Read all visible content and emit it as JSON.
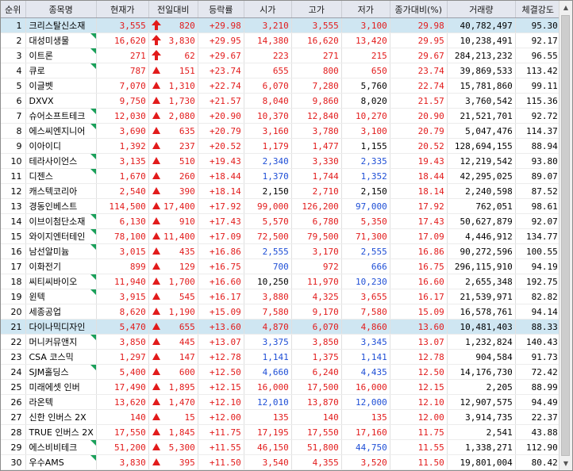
{
  "headers": [
    "순위",
    "종목명",
    "현재가",
    "전일대비",
    "등락률",
    "시가",
    "고가",
    "저가",
    "종가대비(%)",
    "거래량",
    "체결강도"
  ],
  "rows": [
    {
      "rank": "1",
      "name": "크리스탈신소재",
      "price": "3,555",
      "change": "820",
      "pct": "+29.98",
      "open": "3,210",
      "high": "3,555",
      "low": "3,100",
      "prev_pct": "29.98",
      "volume": "40,782,497",
      "strength": "95.30",
      "arrow": "limit",
      "open_dir": "up",
      "high_dir": "up",
      "low_dir": "up",
      "hl": true,
      "flag": false
    },
    {
      "rank": "2",
      "name": "대성미생물",
      "price": "16,620",
      "change": "3,830",
      "pct": "+29.95",
      "open": "14,380",
      "high": "16,620",
      "low": "13,420",
      "prev_pct": "29.95",
      "volume": "10,238,491",
      "strength": "92.17",
      "arrow": "limit",
      "open_dir": "up",
      "high_dir": "up",
      "low_dir": "up",
      "hl": false,
      "flag": true
    },
    {
      "rank": "3",
      "name": "이트론",
      "price": "271",
      "change": "62",
      "pct": "+29.67",
      "open": "223",
      "high": "271",
      "low": "215",
      "prev_pct": "29.67",
      "volume": "284,213,232",
      "strength": "96.55",
      "arrow": "limit",
      "open_dir": "up",
      "high_dir": "up",
      "low_dir": "up",
      "hl": false,
      "flag": true
    },
    {
      "rank": "4",
      "name": "큐로",
      "price": "787",
      "change": "151",
      "pct": "+23.74",
      "open": "655",
      "high": "800",
      "low": "650",
      "prev_pct": "23.74",
      "volume": "39,869,533",
      "strength": "113.42",
      "arrow": "up",
      "open_dir": "up",
      "high_dir": "up",
      "low_dir": "up",
      "hl": false,
      "flag": true
    },
    {
      "rank": "5",
      "name": "이글벳",
      "price": "7,070",
      "change": "1,310",
      "pct": "+22.74",
      "open": "6,070",
      "high": "7,280",
      "low": "5,760",
      "prev_pct": "22.74",
      "volume": "15,781,860",
      "strength": "99.11",
      "arrow": "up",
      "open_dir": "up",
      "high_dir": "up",
      "low_dir": "flat",
      "hl": false,
      "flag": false
    },
    {
      "rank": "6",
      "name": "DXVX",
      "price": "9,750",
      "change": "1,730",
      "pct": "+21.57",
      "open": "8,040",
      "high": "9,860",
      "low": "8,020",
      "prev_pct": "21.57",
      "volume": "3,760,542",
      "strength": "115.36",
      "arrow": "up",
      "open_dir": "up",
      "high_dir": "up",
      "low_dir": "flat",
      "hl": false,
      "flag": false
    },
    {
      "rank": "7",
      "name": "슈어소프트테크",
      "price": "12,030",
      "change": "2,080",
      "pct": "+20.90",
      "open": "10,370",
      "high": "12,840",
      "low": "10,270",
      "prev_pct": "20.90",
      "volume": "21,521,701",
      "strength": "92.72",
      "arrow": "up",
      "open_dir": "up",
      "high_dir": "up",
      "low_dir": "up",
      "hl": false,
      "flag": true
    },
    {
      "rank": "8",
      "name": "에스씨엔지니어",
      "price": "3,690",
      "change": "635",
      "pct": "+20.79",
      "open": "3,160",
      "high": "3,780",
      "low": "3,100",
      "prev_pct": "20.79",
      "volume": "5,047,476",
      "strength": "114.37",
      "arrow": "up",
      "open_dir": "up",
      "high_dir": "up",
      "low_dir": "up",
      "hl": false,
      "flag": true
    },
    {
      "rank": "9",
      "name": "이아이디",
      "price": "1,392",
      "change": "237",
      "pct": "+20.52",
      "open": "1,179",
      "high": "1,477",
      "low": "1,155",
      "prev_pct": "20.52",
      "volume": "128,694,155",
      "strength": "88.94",
      "arrow": "up",
      "open_dir": "up",
      "high_dir": "up",
      "low_dir": "flat",
      "hl": false,
      "flag": false
    },
    {
      "rank": "10",
      "name": "테라사이언스",
      "price": "3,135",
      "change": "510",
      "pct": "+19.43",
      "open": "2,340",
      "high": "3,330",
      "low": "2,335",
      "prev_pct": "19.43",
      "volume": "12,219,542",
      "strength": "93.80",
      "arrow": "up",
      "open_dir": "down",
      "high_dir": "up",
      "low_dir": "down",
      "hl": false,
      "flag": true
    },
    {
      "rank": "11",
      "name": "디젠스",
      "price": "1,670",
      "change": "260",
      "pct": "+18.44",
      "open": "1,370",
      "high": "1,744",
      "low": "1,352",
      "prev_pct": "18.44",
      "volume": "42,295,025",
      "strength": "89.07",
      "arrow": "up",
      "open_dir": "down",
      "high_dir": "up",
      "low_dir": "down",
      "hl": false,
      "flag": true
    },
    {
      "rank": "12",
      "name": "캐스텍코리아",
      "price": "2,540",
      "change": "390",
      "pct": "+18.14",
      "open": "2,150",
      "high": "2,710",
      "low": "2,150",
      "prev_pct": "18.14",
      "volume": "2,240,598",
      "strength": "87.52",
      "arrow": "up",
      "open_dir": "flat",
      "high_dir": "up",
      "low_dir": "flat",
      "hl": false,
      "flag": false
    },
    {
      "rank": "13",
      "name": "경동인베스트",
      "price": "114,500",
      "change": "17,400",
      "pct": "+17.92",
      "open": "99,000",
      "high": "126,200",
      "low": "97,000",
      "prev_pct": "17.92",
      "volume": "762,051",
      "strength": "98.61",
      "arrow": "up",
      "open_dir": "up",
      "high_dir": "up",
      "low_dir": "down",
      "hl": false,
      "flag": false
    },
    {
      "rank": "14",
      "name": "이브이첨단소재",
      "price": "6,130",
      "change": "910",
      "pct": "+17.43",
      "open": "5,570",
      "high": "6,780",
      "low": "5,350",
      "prev_pct": "17.43",
      "volume": "50,627,879",
      "strength": "92.07",
      "arrow": "up",
      "open_dir": "up",
      "high_dir": "up",
      "low_dir": "up",
      "hl": false,
      "flag": true
    },
    {
      "rank": "15",
      "name": "와이지엔터테인",
      "price": "78,100",
      "change": "11,400",
      "pct": "+17.09",
      "open": "72,500",
      "high": "79,500",
      "low": "71,300",
      "prev_pct": "17.09",
      "volume": "4,446,912",
      "strength": "134.77",
      "arrow": "up",
      "open_dir": "up",
      "high_dir": "up",
      "low_dir": "up",
      "hl": false,
      "flag": true
    },
    {
      "rank": "16",
      "name": "남선알미늄",
      "price": "3,015",
      "change": "435",
      "pct": "+16.86",
      "open": "2,555",
      "high": "3,170",
      "low": "2,555",
      "prev_pct": "16.86",
      "volume": "90,272,596",
      "strength": "100.55",
      "arrow": "up",
      "open_dir": "down",
      "high_dir": "up",
      "low_dir": "down",
      "hl": false,
      "flag": true
    },
    {
      "rank": "17",
      "name": "이화전기",
      "price": "899",
      "change": "129",
      "pct": "+16.75",
      "open": "700",
      "high": "972",
      "low": "666",
      "prev_pct": "16.75",
      "volume": "296,115,910",
      "strength": "94.19",
      "arrow": "up",
      "open_dir": "down",
      "high_dir": "up",
      "low_dir": "down",
      "hl": false,
      "flag": false
    },
    {
      "rank": "18",
      "name": "씨티씨바이오",
      "price": "11,940",
      "change": "1,700",
      "pct": "+16.60",
      "open": "10,250",
      "high": "11,970",
      "low": "10,230",
      "prev_pct": "16.60",
      "volume": "2,655,348",
      "strength": "192.75",
      "arrow": "up",
      "open_dir": "flat",
      "high_dir": "up",
      "low_dir": "down",
      "hl": false,
      "flag": true
    },
    {
      "rank": "19",
      "name": "윈텍",
      "price": "3,915",
      "change": "545",
      "pct": "+16.17",
      "open": "3,880",
      "high": "4,325",
      "low": "3,655",
      "prev_pct": "16.17",
      "volume": "21,539,971",
      "strength": "82.82",
      "arrow": "up",
      "open_dir": "up",
      "high_dir": "up",
      "low_dir": "up",
      "hl": false,
      "flag": true
    },
    {
      "rank": "20",
      "name": "세종공업",
      "price": "8,620",
      "change": "1,190",
      "pct": "+15.09",
      "open": "7,580",
      "high": "9,170",
      "low": "7,580",
      "prev_pct": "15.09",
      "volume": "16,578,761",
      "strength": "94.14",
      "arrow": "up",
      "open_dir": "up",
      "high_dir": "up",
      "low_dir": "up",
      "hl": false,
      "flag": false
    },
    {
      "rank": "21",
      "name": "다이나믹디자인",
      "price": "5,470",
      "change": "655",
      "pct": "+13.60",
      "open": "4,870",
      "high": "6,070",
      "low": "4,860",
      "prev_pct": "13.60",
      "volume": "10,481,403",
      "strength": "88.33",
      "arrow": "up",
      "open_dir": "up",
      "high_dir": "up",
      "low_dir": "up",
      "hl": true,
      "flag": false
    },
    {
      "rank": "22",
      "name": "머니커뮤앤지",
      "price": "3,850",
      "change": "445",
      "pct": "+13.07",
      "open": "3,375",
      "high": "3,850",
      "low": "3,345",
      "prev_pct": "13.07",
      "volume": "1,232,824",
      "strength": "140.43",
      "arrow": "up",
      "open_dir": "down",
      "high_dir": "up",
      "low_dir": "down",
      "hl": false,
      "flag": true
    },
    {
      "rank": "23",
      "name": "CSA 코스믹",
      "price": "1,297",
      "change": "147",
      "pct": "+12.78",
      "open": "1,141",
      "high": "1,375",
      "low": "1,141",
      "prev_pct": "12.78",
      "volume": "904,584",
      "strength": "91.73",
      "arrow": "up",
      "open_dir": "down",
      "high_dir": "up",
      "low_dir": "down",
      "hl": false,
      "flag": false
    },
    {
      "rank": "24",
      "name": "SJM홀딩스",
      "price": "5,400",
      "change": "600",
      "pct": "+12.50",
      "open": "4,660",
      "high": "6,240",
      "low": "4,435",
      "prev_pct": "12.50",
      "volume": "14,176,730",
      "strength": "72.42",
      "arrow": "up",
      "open_dir": "down",
      "high_dir": "up",
      "low_dir": "down",
      "hl": false,
      "flag": true
    },
    {
      "rank": "25",
      "name": "미래에셋 인버",
      "price": "17,490",
      "change": "1,895",
      "pct": "+12.15",
      "open": "16,000",
      "high": "17,500",
      "low": "16,000",
      "prev_pct": "12.15",
      "volume": "2,205",
      "strength": "88.99",
      "arrow": "up",
      "open_dir": "up",
      "high_dir": "up",
      "low_dir": "up",
      "hl": false,
      "flag": false
    },
    {
      "rank": "26",
      "name": "라온텍",
      "price": "13,620",
      "change": "1,470",
      "pct": "+12.10",
      "open": "12,010",
      "high": "13,870",
      "low": "12,000",
      "prev_pct": "12.10",
      "volume": "12,907,575",
      "strength": "94.49",
      "arrow": "up",
      "open_dir": "down",
      "high_dir": "up",
      "low_dir": "down",
      "hl": false,
      "flag": false
    },
    {
      "rank": "27",
      "name": "신한 인버스 2X",
      "price": "140",
      "change": "15",
      "pct": "+12.00",
      "open": "135",
      "high": "140",
      "low": "135",
      "prev_pct": "12.00",
      "volume": "3,914,735",
      "strength": "22.37",
      "arrow": "up",
      "open_dir": "up",
      "high_dir": "up",
      "low_dir": "up",
      "hl": false,
      "flag": false
    },
    {
      "rank": "28",
      "name": "TRUE 인버스 2X",
      "price": "17,550",
      "change": "1,845",
      "pct": "+11.75",
      "open": "17,195",
      "high": "17,550",
      "low": "17,160",
      "prev_pct": "11.75",
      "volume": "2,541",
      "strength": "43.88",
      "arrow": "up",
      "open_dir": "up",
      "high_dir": "up",
      "low_dir": "up",
      "hl": false,
      "flag": false
    },
    {
      "rank": "29",
      "name": "에스비비테크",
      "price": "51,200",
      "change": "5,300",
      "pct": "+11.55",
      "open": "46,150",
      "high": "51,800",
      "low": "44,750",
      "prev_pct": "11.55",
      "volume": "1,338,271",
      "strength": "112.90",
      "arrow": "up",
      "open_dir": "up",
      "high_dir": "up",
      "low_dir": "down",
      "hl": false,
      "flag": true
    },
    {
      "rank": "30",
      "name": "우수AMS",
      "price": "3,830",
      "change": "395",
      "pct": "+11.50",
      "open": "3,540",
      "high": "4,355",
      "low": "3,520",
      "prev_pct": "11.50",
      "volume": "19,801,004",
      "strength": "80.42",
      "arrow": "up",
      "open_dir": "up",
      "high_dir": "up",
      "low_dir": "up",
      "hl": false,
      "flag": true
    }
  ]
}
